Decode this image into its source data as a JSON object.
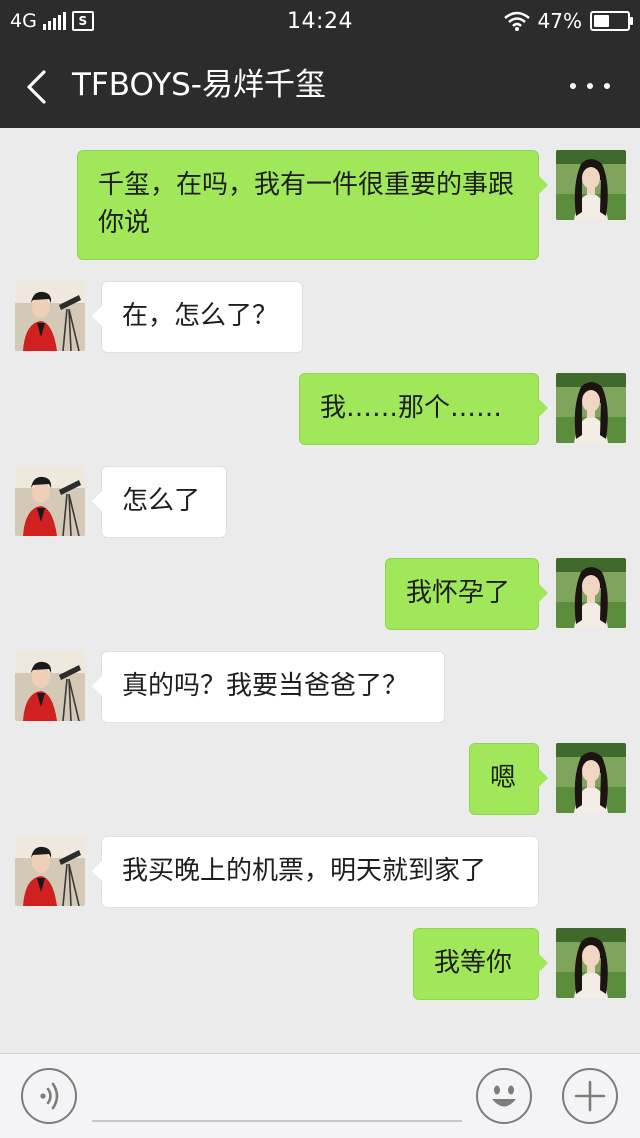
{
  "status_bar": {
    "network": "4G",
    "time": "14:24",
    "battery_percent": "47%",
    "battery_level": 0.47,
    "icons": [
      "signal-icon",
      "s-notification-icon",
      "wifi-icon",
      "battery-icon"
    ]
  },
  "header": {
    "back_icon": "chevron-left-icon",
    "title": "TFBOYS-易烊千玺",
    "more_icon": "more-dots-icon"
  },
  "colors": {
    "header_bg": "#2c2c2c",
    "chat_bg": "#ebebeb",
    "outgoing_bubble": "#a0e75a",
    "incoming_bubble": "#ffffff"
  },
  "messages": [
    {
      "side": "right",
      "text": "千玺，在吗，我有一件很重要的事跟你说"
    },
    {
      "side": "left",
      "text": "在，怎么了？"
    },
    {
      "side": "right",
      "text": "我……那个……"
    },
    {
      "side": "left",
      "text": "怎么了"
    },
    {
      "side": "right",
      "text": "我怀孕了"
    },
    {
      "side": "left",
      "text": "真的吗？我要当爸爸了？"
    },
    {
      "side": "right",
      "text": "嗯"
    },
    {
      "side": "left",
      "text": "我买晚上的机票，明天就到家了"
    },
    {
      "side": "right",
      "text": "我等你"
    }
  ],
  "input_bar": {
    "voice_icon": "voice-icon",
    "emoji_icon": "emoji-icon",
    "plus_icon": "plus-icon",
    "text_value": ""
  }
}
